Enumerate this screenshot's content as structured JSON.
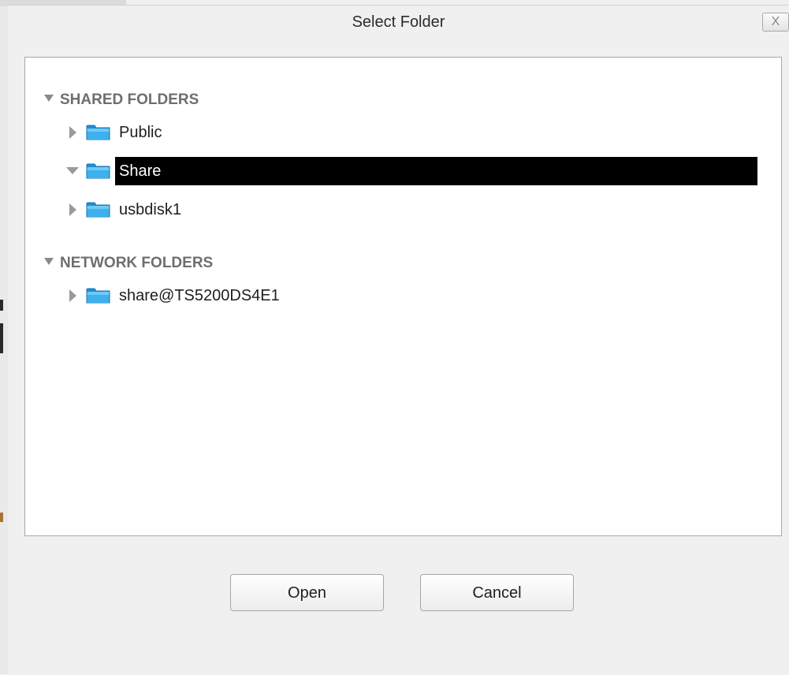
{
  "dialog": {
    "title": "Select Folder",
    "close_label": "X"
  },
  "tree": {
    "sections": [
      {
        "header": "SHARED FOLDERS",
        "expanded": true,
        "items": [
          {
            "label": "Public",
            "expanded": false,
            "selected": false,
            "icon": "folder-icon"
          },
          {
            "label": "Share",
            "expanded": true,
            "selected": true,
            "icon": "folder-icon"
          },
          {
            "label": "usbdisk1",
            "expanded": false,
            "selected": false,
            "icon": "folder-icon"
          }
        ]
      },
      {
        "header": "NETWORK FOLDERS",
        "expanded": true,
        "items": [
          {
            "label": "share@TS5200DS4E1",
            "expanded": false,
            "selected": false,
            "icon": "folder-icon"
          }
        ]
      }
    ]
  },
  "buttons": {
    "open_label": "Open",
    "cancel_label": "Cancel"
  },
  "colors": {
    "selection_bg": "#000000",
    "selection_text": "#ffffff",
    "folder_blue": "#29a3e6",
    "section_header": "#6e6e6e"
  }
}
